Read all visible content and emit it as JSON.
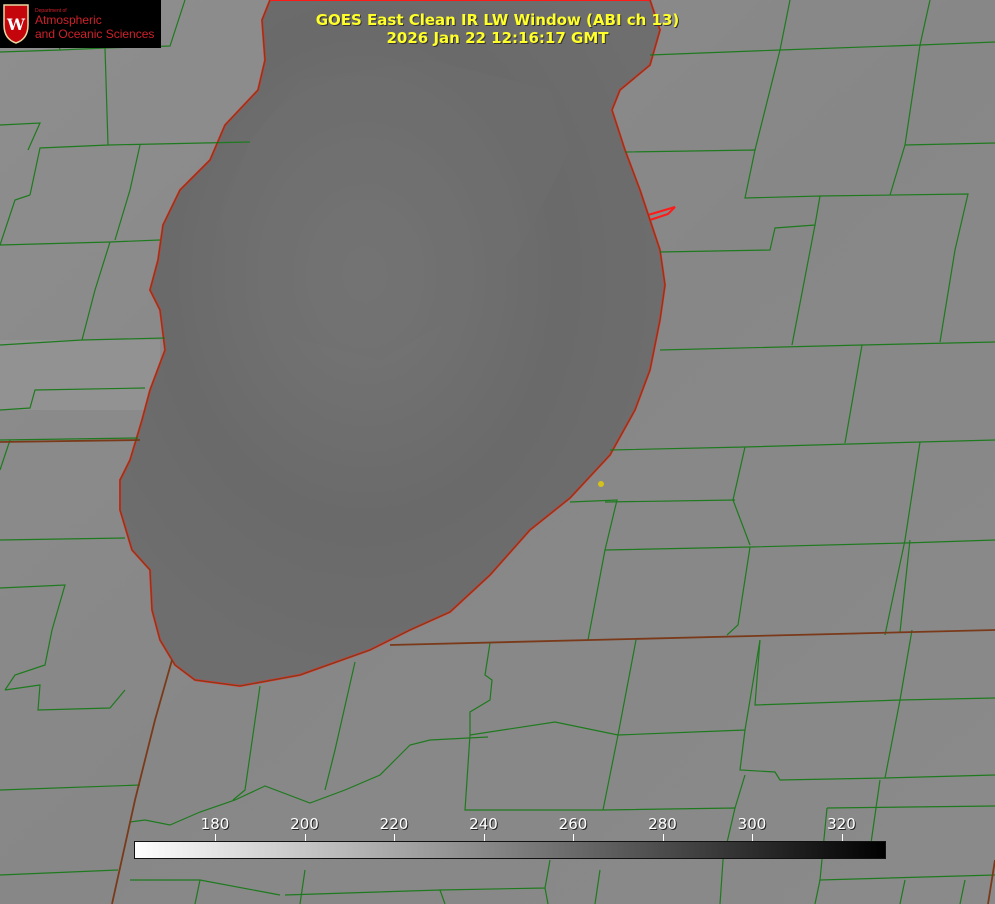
{
  "title": {
    "line1": "GOES East Clean IR LW Window (ABI ch 13)",
    "line2": "2026 Jan 22 12:16:17 GMT"
  },
  "logo": {
    "line1": "Department of",
    "line2": "Atmospheric",
    "line3": "and Oceanic Sciences",
    "seal_letter": "W"
  },
  "colorbar": {
    "ticks": [
      "180",
      "200",
      "220",
      "240",
      "260",
      "280",
      "300",
      "320"
    ],
    "gradient_start": "#ffffff",
    "gradient_end": "#000000"
  },
  "colors": {
    "county_lines": "#1e7a1e",
    "coastline": "#ff1a1a",
    "state_lines": "#7a3a1a",
    "title": "#ffff2a",
    "marker": "#d4c21a"
  }
}
